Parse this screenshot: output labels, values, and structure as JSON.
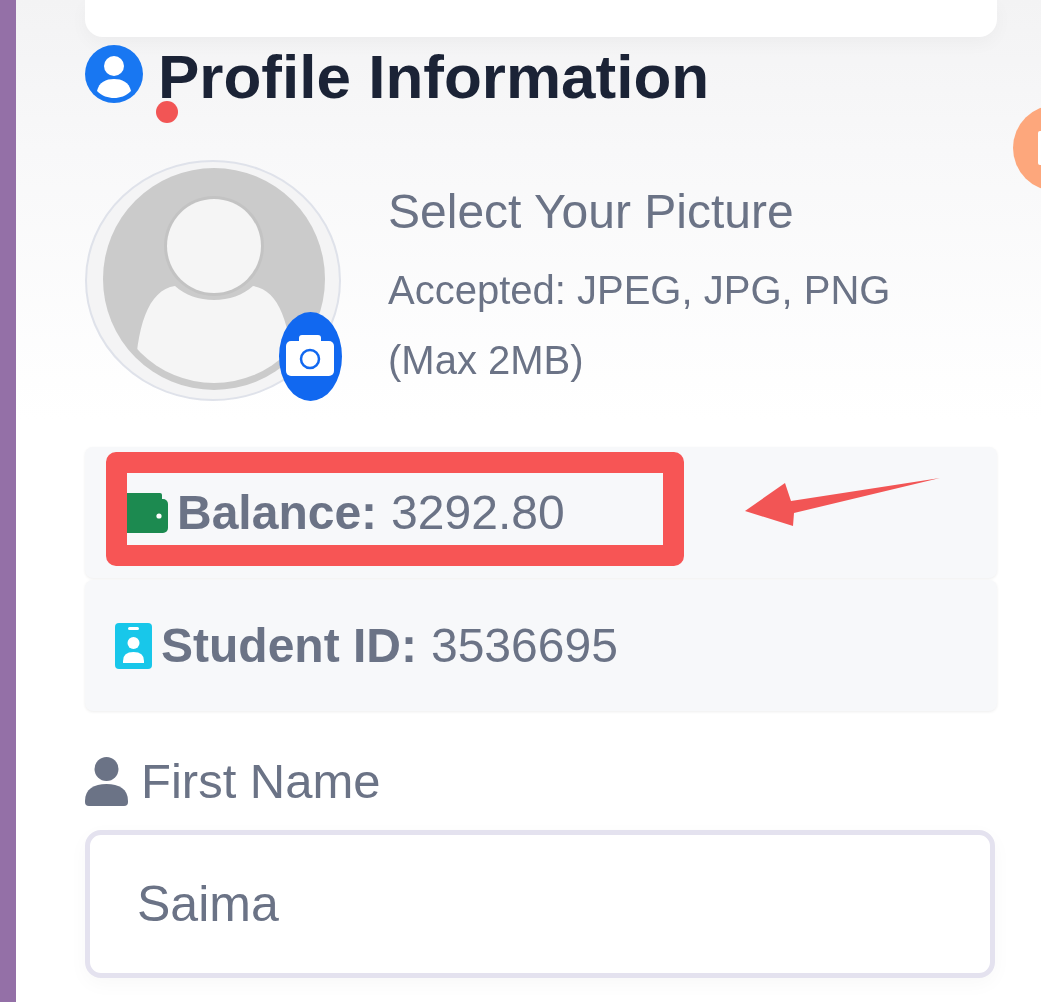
{
  "heading": {
    "title": "Profile Information"
  },
  "picture": {
    "title": "Select Your Picture",
    "formats": "Accepted: JPEG, JPG, PNG",
    "limit": "(Max 2MB)"
  },
  "details": [
    {
      "kind": "balance",
      "label": "Balance:",
      "value": "3292.80",
      "highlighted": true
    },
    {
      "kind": "student_id",
      "label": "Student ID:",
      "value": "3536695",
      "highlighted": false
    }
  ],
  "fields": [
    {
      "label": "First Name",
      "value": "Saima"
    }
  ]
}
